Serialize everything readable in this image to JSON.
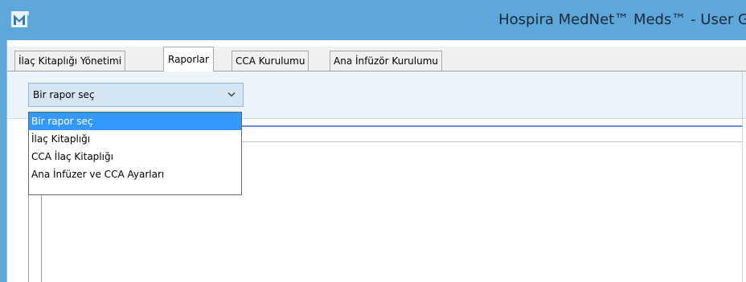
{
  "window": {
    "title": "Hospira MedNet™ Meds™ - User G",
    "app_icon": "mednet-logo-icon"
  },
  "tabs": [
    {
      "label": "İlaç Kitaplığı Yönetimi",
      "active": false
    },
    {
      "label": "Raporlar",
      "active": true
    },
    {
      "label": "CCA Kurulumu",
      "active": false
    },
    {
      "label": "Ana İnfüzör Kurulumu",
      "active": false
    }
  ],
  "report_select": {
    "value": "Bir rapor seç",
    "icon": "chevron-down-icon",
    "options": [
      {
        "label": "Bir rapor seç",
        "selected": true
      },
      {
        "label": "İlaç Kitaplığı",
        "selected": false
      },
      {
        "label": "CCA İlaç Kitaplığı",
        "selected": false
      },
      {
        "label": "Ana İnfüzer ve CCA Ayarları",
        "selected": false
      }
    ]
  },
  "colors": {
    "titlebar": "#5ea7da",
    "select_bg": "#d4e6f4",
    "highlight": "#3399ff",
    "rule": "#6b8ed6"
  }
}
